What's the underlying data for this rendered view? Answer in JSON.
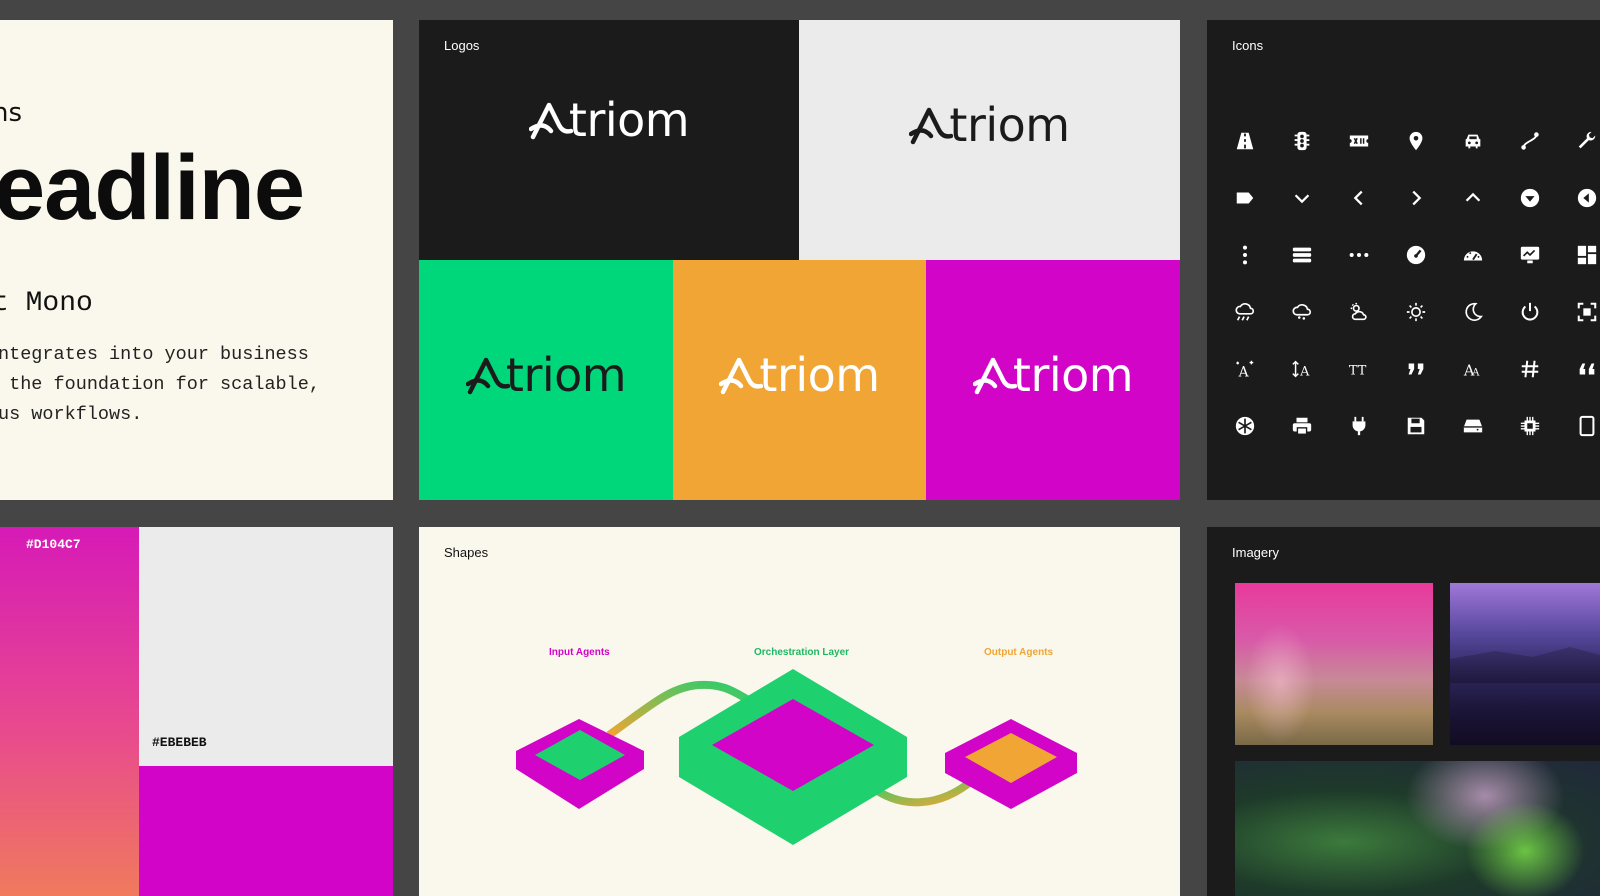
{
  "typography": {
    "line1": "ns",
    "headline": "eadline",
    "font_name": "t Mono",
    "body_lines": [
      "ntegrates into your business",
      " the foundation for scalable,",
      "us workflows."
    ]
  },
  "logos": {
    "title": "Logos",
    "wordmark": "triom",
    "tiles": [
      {
        "bg": "#1B1B1B",
        "fg": "#FFFFFF"
      },
      {
        "bg": "#EBEBEB",
        "fg": "#1B1B1B"
      },
      {
        "bg": "#00D67A",
        "fg": "#1B1B1B"
      },
      {
        "bg": "#F0A534",
        "fg": "#FFFFFF"
      },
      {
        "bg": "#D104C7",
        "fg": "#FFFFFF"
      }
    ]
  },
  "icons": {
    "title": "Icons",
    "items": [
      "road-icon",
      "traffic-light-icon",
      "ticket-icon",
      "map-pin-icon",
      "car-icon",
      "route-icon",
      "wrench-icon",
      "tag-icon",
      "chevron-down-icon",
      "chevron-left-icon",
      "chevron-right-icon",
      "chevron-up-icon",
      "circle-caret-down-icon",
      "circle-caret-left-icon",
      "dots-vertical-icon",
      "menu-icon",
      "dots-horizontal-icon",
      "gauge-icon",
      "speedometer-icon",
      "monitor-chart-icon",
      "dashboard-icon",
      "cloud-rain-icon",
      "cloud-drizzle-icon",
      "sun-cloud-icon",
      "sun-icon",
      "moon-icon",
      "power-icon",
      "focus-icon",
      "text-sparkle-icon",
      "text-size-icon",
      "text-tt-icon",
      "quote-icon",
      "font-icon",
      "hash-icon",
      "quote-open-icon",
      "snowflake-icon",
      "printer-icon",
      "plug-icon",
      "save-icon",
      "hard-drive-icon",
      "chip-icon",
      "tablet-icon"
    ]
  },
  "colors": {
    "swatches": [
      {
        "hex": "#D104C7",
        "label": "#D104C7"
      },
      {
        "hex": "#EBEBEB",
        "label": "#EBEBEB"
      },
      {
        "hex": "#D104C7",
        "label": ""
      }
    ]
  },
  "shapes": {
    "title": "Shapes",
    "labels": [
      {
        "text": "Input Agents",
        "color": "#D104C7"
      },
      {
        "text": "Orchestration Layer",
        "color": "#1FB862"
      },
      {
        "text": "Output Agents",
        "color": "#F0A534"
      }
    ]
  },
  "imagery": {
    "title": "Imagery"
  }
}
